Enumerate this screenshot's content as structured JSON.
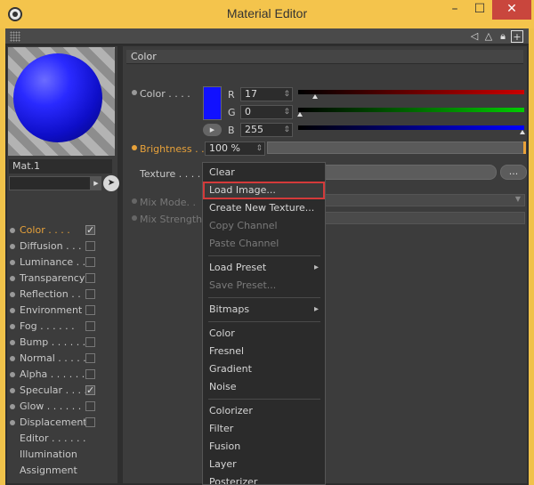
{
  "window": {
    "title": "Material Editor",
    "minimize": "–",
    "maximize": "☐",
    "close": "✕"
  },
  "left_panel": {
    "material_name": "Mat.1",
    "channels": [
      {
        "label": "Color",
        "dots": " . . . .",
        "checked": true,
        "active": true
      },
      {
        "label": "Diffusion",
        "dots": " . . . . .",
        "checked": false,
        "active": false
      },
      {
        "label": "Luminance",
        "dots": " . . .",
        "checked": false,
        "active": false
      },
      {
        "label": "Transparency",
        "dots": "",
        "checked": false,
        "active": false
      },
      {
        "label": "Reflection",
        "dots": " . .",
        "checked": false,
        "active": false
      },
      {
        "label": "Environment",
        "dots": "",
        "checked": false,
        "active": false
      },
      {
        "label": "Fog",
        "dots": " . . . . . .",
        "checked": false,
        "active": false
      },
      {
        "label": "Bump",
        "dots": " . . . . . .",
        "checked": false,
        "active": false
      },
      {
        "label": "Normal",
        "dots": " . . . . .",
        "checked": false,
        "active": false
      },
      {
        "label": "Alpha",
        "dots": " . . . . . .",
        "checked": false,
        "active": false
      },
      {
        "label": "Specular",
        "dots": " . . . .",
        "checked": true,
        "active": false
      },
      {
        "label": "Glow",
        "dots": " . . . . . .",
        "checked": false,
        "active": false
      },
      {
        "label": "Displacement",
        "dots": "",
        "checked": false,
        "active": false
      }
    ],
    "extra": [
      "Editor . . . . . .",
      "Illumination",
      "Assignment"
    ]
  },
  "color_section": {
    "header": "Color",
    "color_label": "Color . . . .",
    "swatch_color": "#1111ff",
    "channels": [
      {
        "label": "R",
        "value": "17",
        "fraction": 0.067
      },
      {
        "label": "G",
        "value": "0",
        "fraction": 0.0
      },
      {
        "label": "B",
        "value": "255",
        "fraction": 1.0
      }
    ],
    "brightness_label": "Brightness . .",
    "brightness_value": "100 %",
    "texture_label": "Texture . . . . . .",
    "texture_more": "...",
    "mix_mode_label": "Mix Mode. .",
    "mix_strength_label": "Mix Strength"
  },
  "texture_menu": {
    "items": [
      {
        "label": "Clear",
        "disabled": false,
        "submenu": false,
        "highlighted": false
      },
      {
        "label": "Load Image...",
        "disabled": false,
        "submenu": false,
        "highlighted": true
      },
      {
        "label": "Create New Texture...",
        "disabled": false,
        "submenu": false,
        "highlighted": false
      },
      {
        "label": "Copy Channel",
        "disabled": true,
        "submenu": false,
        "highlighted": false
      },
      {
        "label": "Paste Channel",
        "disabled": true,
        "submenu": false,
        "highlighted": false
      },
      {
        "label": "Load Preset",
        "disabled": false,
        "submenu": true,
        "highlighted": false
      },
      {
        "label": "Save Preset...",
        "disabled": true,
        "submenu": false,
        "highlighted": false
      },
      {
        "label": "Bitmaps",
        "disabled": false,
        "submenu": true,
        "highlighted": false
      },
      {
        "label": "Color",
        "disabled": false,
        "submenu": false,
        "highlighted": false
      },
      {
        "label": "Fresnel",
        "disabled": false,
        "submenu": false,
        "highlighted": false
      },
      {
        "label": "Gradient",
        "disabled": false,
        "submenu": false,
        "highlighted": false
      },
      {
        "label": "Noise",
        "disabled": false,
        "submenu": false,
        "highlighted": false
      },
      {
        "label": "Colorizer",
        "disabled": false,
        "submenu": false,
        "highlighted": false
      },
      {
        "label": "Filter",
        "disabled": false,
        "submenu": false,
        "highlighted": false
      },
      {
        "label": "Fusion",
        "disabled": false,
        "submenu": false,
        "highlighted": false
      },
      {
        "label": "Layer",
        "disabled": false,
        "submenu": false,
        "highlighted": false
      },
      {
        "label": "Posterizer",
        "disabled": false,
        "submenu": false,
        "highlighted": false
      }
    ]
  }
}
